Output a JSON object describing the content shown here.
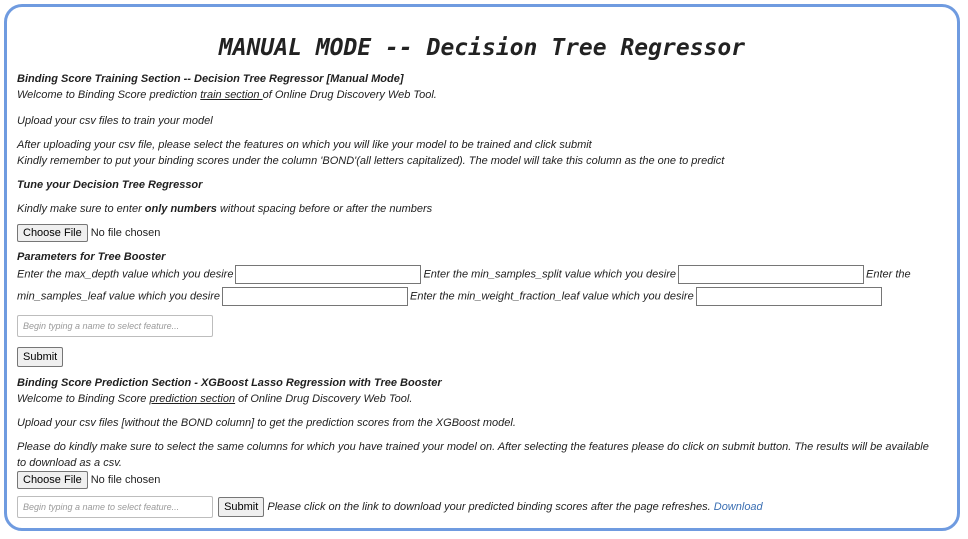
{
  "page": {
    "title": "MANUAL MODE -- Decision Tree Regressor"
  },
  "training": {
    "heading": "Binding Score Training Section -- Decision Tree Regressor [Manual Mode]",
    "welcome_prefix": "Welcome to Binding Score prediction ",
    "welcome_link": "train section ",
    "welcome_suffix": "of Online Drug Discovery Web Tool.",
    "upload_text": "Upload your csv files to train your model",
    "instructions_line1": "After uploading your csv file, please select the features on which you will like your model to be trained and click submit",
    "instructions_line2": "Kindly remember to put your binding scores under the column 'BOND'(all letters capitalized). The model will take this column as the one to predict",
    "tune_heading": "Tune your Decision Tree Regressor",
    "numbers_prefix": "Kindly make sure to enter ",
    "numbers_bold": "only numbers",
    "numbers_suffix": " without spacing before or after the numbers",
    "choose_file_label": "Choose File",
    "no_file_text": "No file chosen",
    "params_heading": "Parameters for Tree Booster",
    "max_depth_label": "Enter the max_depth value which you desire",
    "min_samples_split_label": "Enter the min_samples_split value which you desire",
    "min_samples_leaf_prefix": "Enter the",
    "min_samples_leaf_label": "min_samples_leaf value which you desire",
    "min_weight_fraction_label": "Enter the min_weight_fraction_leaf value which you desire",
    "feature_placeholder": "Begin typing a name to select feature...",
    "submit_label": "Submit"
  },
  "prediction": {
    "heading": "Binding Score Prediction Section - XGBoost Lasso Regression with Tree Booster",
    "welcome_prefix": "Welcome to Binding Score ",
    "welcome_link": "prediction section",
    "welcome_suffix": " of Online Drug Discovery Web Tool.",
    "upload_text": "Upload your csv files [without the BOND column] to get the prediction scores from the XGBoost model.",
    "instructions_line1": "Please do kindly make sure to select the same columns for which you have trained your model on. After selecting the features please do click on submit button. The results will be available",
    "instructions_line2": "to download as a csv.",
    "choose_file_label": "Choose File",
    "no_file_text": "No file chosen",
    "feature_placeholder": "Begin typing a name to select feature...",
    "submit_label": "Submit",
    "download_prompt": " Please click on the link to download your predicted binding scores after the page refreshes. ",
    "download_link": "Download"
  },
  "colors": {
    "frame_border": "#6f9be0",
    "link": "#3b6fb3"
  }
}
